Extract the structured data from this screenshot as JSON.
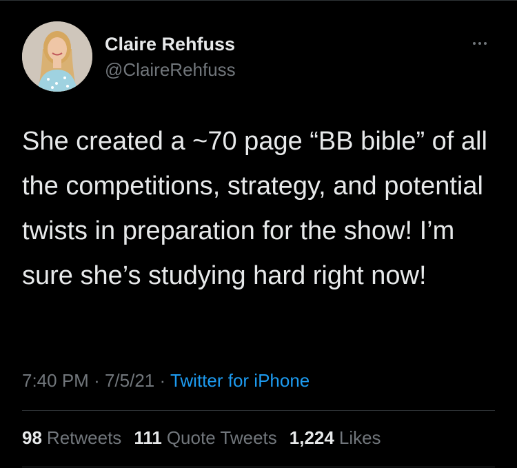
{
  "user": {
    "display_name": "Claire Rehfuss",
    "handle": "@ClaireRehfuss"
  },
  "tweet": {
    "text": "She created a ~70 page “BB bible” of all the competitions, strategy, and potential twists in preparation for the show! I’m sure she’s studying hard right now!",
    "time": "7:40 PM",
    "date": "7/5/21",
    "separator": "·",
    "source": "Twitter for iPhone"
  },
  "stats": {
    "retweets_count": "98",
    "retweets_label": "Retweets",
    "quotes_count": "111",
    "quotes_label": "Quote Tweets",
    "likes_count": "1,224",
    "likes_label": "Likes"
  },
  "colors": {
    "background": "#000000",
    "primary_text": "#e7e9ea",
    "secondary_text": "#71767b",
    "link": "#1d9bf0",
    "divider": "#2f3336"
  },
  "icons": {
    "more": "more-horizontal-icon"
  }
}
